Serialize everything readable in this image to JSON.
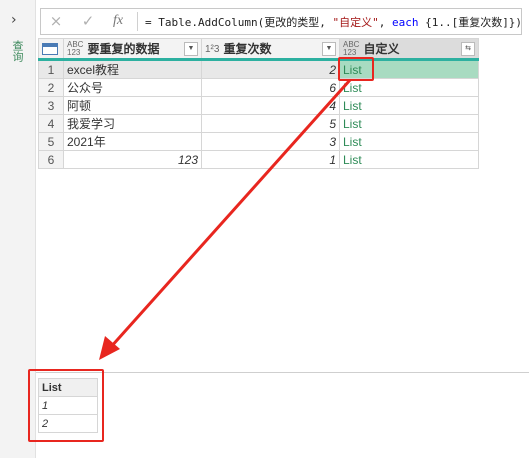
{
  "left_pane": {
    "expand_icon": "chevron-right-icon",
    "label": "查询"
  },
  "formula_bar": {
    "cancel_icon": "×",
    "confirm_icon": "✓",
    "fx": "fx",
    "expr_prefix": "= Table.AddColumn(更改的类型, ",
    "expr_string": "\"自定义\"",
    "expr_mid": ", ",
    "expr_keyword": "each",
    "expr_suffix": " {1..[重复次数]})"
  },
  "grid": {
    "columns": [
      {
        "type_icon": "ABC\n123",
        "label": "要重复的数据"
      },
      {
        "type_icon": "1²3",
        "label": "重复次数"
      },
      {
        "type_icon": "ABC\n123",
        "label": "自定义"
      }
    ],
    "rows": [
      {
        "n": "1",
        "data": "excel教程",
        "count": "2",
        "custom": "List"
      },
      {
        "n": "2",
        "data": "公众号",
        "count": "6",
        "custom": "List"
      },
      {
        "n": "3",
        "data": "阿顿",
        "count": "4",
        "custom": "List"
      },
      {
        "n": "4",
        "data": "我爱学习",
        "count": "5",
        "custom": "List"
      },
      {
        "n": "5",
        "data": "2021年",
        "count": "3",
        "custom": "List"
      },
      {
        "n": "6",
        "data": "123",
        "count": "1",
        "custom": "List"
      }
    ]
  },
  "preview": {
    "header": "List",
    "values": [
      "1",
      "2"
    ]
  },
  "colors": {
    "accent": "#2db0a0",
    "highlight": "#a8dbc1",
    "annotation": "#e8261f"
  }
}
